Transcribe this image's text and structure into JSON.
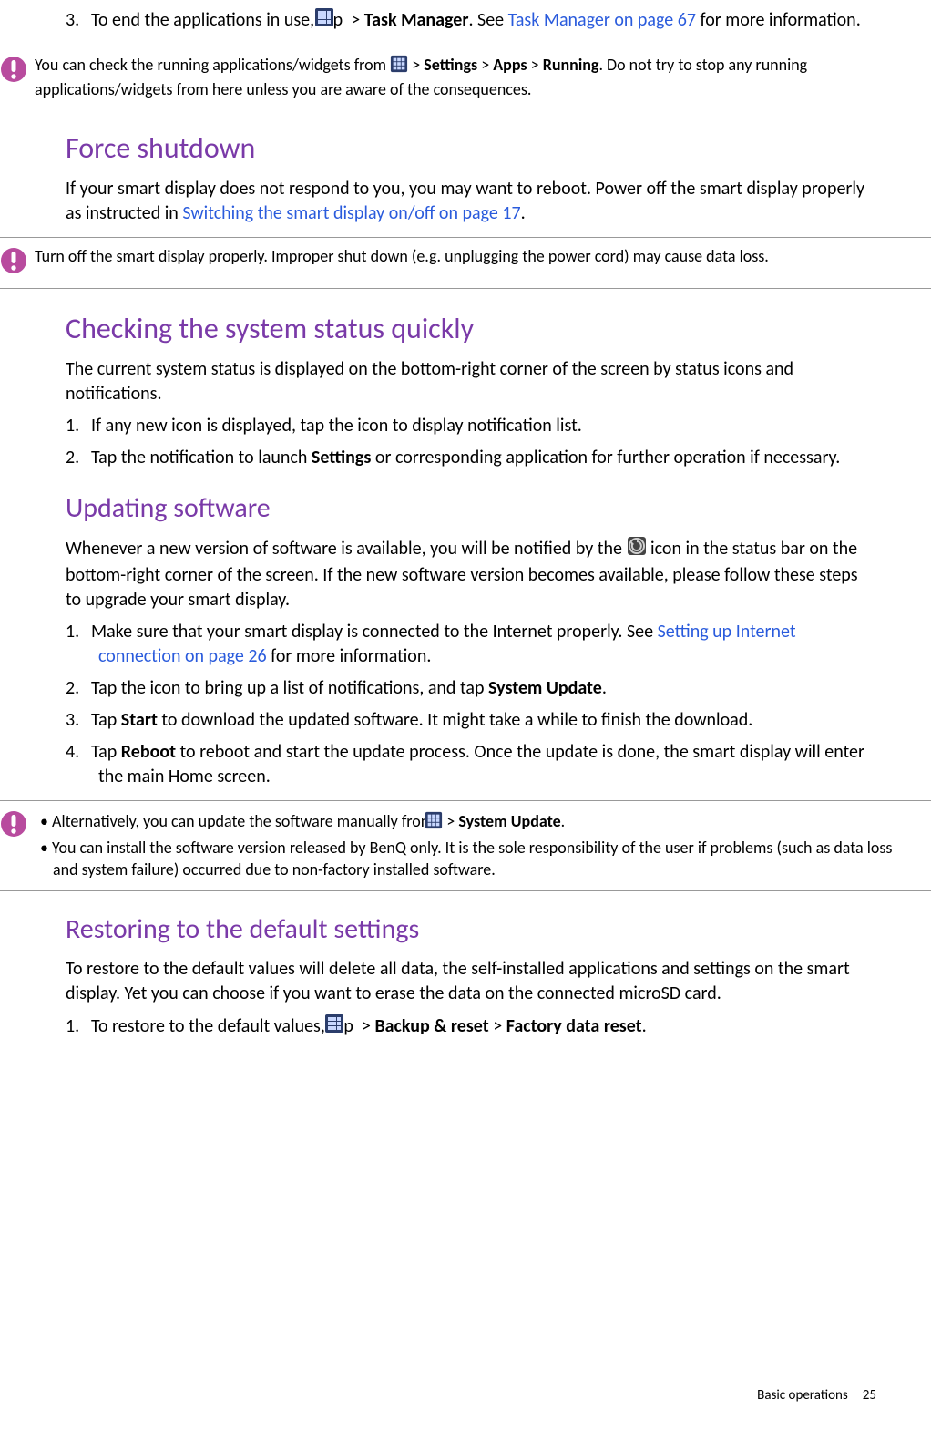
{
  "step3": {
    "num": "3.",
    "pre": "To end the applications in use, tap ",
    "mid": " > ",
    "tm": "Task Manager",
    "see": ". See ",
    "link": "Task Manager on page 67",
    "post": " for more information."
  },
  "callout1": {
    "pre": "You can check the running applications/widgets from ",
    "seq": " > ",
    "s": "Settings",
    "a": "Apps",
    "r": "Running",
    "post": ". Do not try to stop any running applications/widgets from here unless you are aware of the consequences."
  },
  "force": {
    "title": "Force shutdown",
    "body_pre": "If your smart display does not respond to you, you may want to reboot. Power off the smart display properly as instructed in ",
    "link": "Switching the smart display on/off on page 17",
    "body_post": "."
  },
  "callout2": "Turn off the smart display properly. Improper shut down (e.g. unplugging the power cord) may cause data loss.",
  "checking": {
    "title": "Checking the system status quickly",
    "body": "The current system status is displayed on the bottom-right corner of the screen by status icons and notifications.",
    "s1_num": "1.",
    "s1": "If any new icon is displayed, tap the icon to display notification list.",
    "s2_num": "2.",
    "s2_pre": "Tap the notification to launch ",
    "s2_b": "Settings",
    "s2_post": " or corresponding application for further operation if necessary."
  },
  "updating": {
    "title": "Updating software",
    "body_pre": "Whenever a new version of software is available, you will be notified by the ",
    "body_post": " icon in the status bar on the bottom-right corner of the screen. If the new software version becomes available, please follow these steps to upgrade your smart display.",
    "s1_num": "1.",
    "s1_pre": "Make sure that your smart display is connected to the Internet properly. See ",
    "s1_link": "Setting up Internet connection on page 26",
    "s1_post": " for more information.",
    "s2_num": "2.",
    "s2_pre": "Tap the icon to bring up a list of notifications, and tap ",
    "s2_b": "System Update",
    "s2_post": ".",
    "s3_num": "3.",
    "s3_pre": "Tap ",
    "s3_b": "Start",
    "s3_post": " to download the updated software. It might take a while to finish the download.",
    "s4_num": "4.",
    "s4_pre": "Tap ",
    "s4_b": "Reboot",
    "s4_post": " to reboot and start the update process. Once the update is done, the smart display will enter the main Home screen."
  },
  "callout3": {
    "bullet": "• ",
    "l1_pre": "Alternatively, you can update the software manually from ",
    "l1_mid": " > ",
    "l1_b": "System Update",
    "l1_post": ".",
    "l2": "You can install the software version released by BenQ only. It is the sole responsibility of the user if problems (such as data loss and system failure) occurred due to non-factory installed software."
  },
  "restoring": {
    "title": "Restoring to the default settings",
    "body": "To restore to the default values will delete all data, the self-installed applications and settings on the smart display. Yet you can choose if you want to erase the data on the connected microSD card.",
    "s1_num": "1.",
    "s1_pre": "To restore to the default values, tap ",
    "s1_mid": " > ",
    "s1_b1": "Backup & reset",
    "s1_b2": "Factory data reset",
    "s1_post": "."
  },
  "footer": {
    "section": "Basic operations",
    "page": "25"
  }
}
